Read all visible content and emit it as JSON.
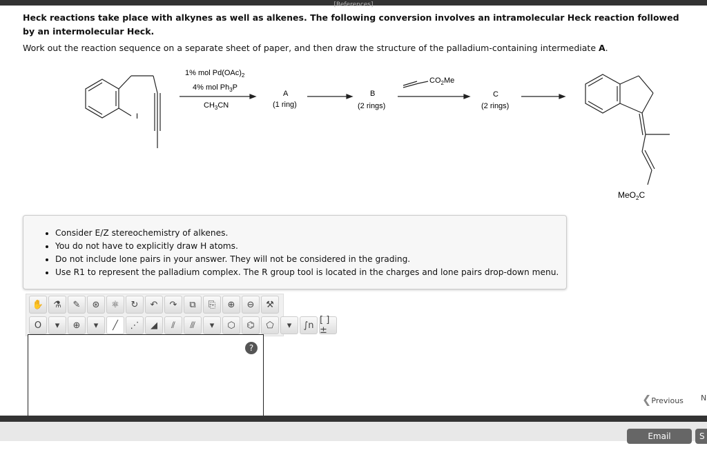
{
  "header": {
    "references": "[References]"
  },
  "question": {
    "title": "Heck reactions take place with alkynes as well as alkenes. The following conversion involves an intramolecular Heck reaction followed by an intermolecular Heck.",
    "instruction_prefix": "Work out the reaction sequence on a separate sheet of paper, and then draw the structure of the palladium-containing intermediate ",
    "instruction_bold": "A",
    "instruction_suffix": "."
  },
  "scheme": {
    "iodo": "I",
    "reagent1": "1% mol Pd(OAc)",
    "reagent1_sub": "2",
    "reagent2": "4% mol Ph",
    "reagent2_sub": "3",
    "reagent2_end": "P",
    "solvent": "CH",
    "solvent_sub": "3",
    "solvent_end": "CN",
    "A": "A",
    "A_note": "(1 ring)",
    "B": "B",
    "B_note": "(2 rings)",
    "alkene_reagent": "CO",
    "alkene_sub": "2",
    "alkene_end": "Me",
    "C": "C",
    "C_note": "(2 rings)",
    "product_ester": "MeO",
    "product_sub": "2",
    "product_end": "C"
  },
  "hints": [
    "Consider E/Z stereochemistry of alkenes.",
    "You do not have to explicitly draw H atoms.",
    "Do not include lone pairs in your answer. They will not be considered in the grading.",
    "Use R1 to represent the palladium complex. The R group tool is located in the charges and lone pairs drop-down menu."
  ],
  "toolbar": {
    "row1": [
      "✋",
      "⚗",
      "✎",
      "⊛",
      "⚛",
      "↻",
      "↶",
      "↷",
      "⧉",
      "⎘",
      "⊕",
      "⊖",
      "⚒"
    ],
    "row2": [
      "O",
      "▾",
      "⊕",
      "▾",
      "╱",
      "⋰",
      "◢",
      "⫽",
      "⫻",
      "▾",
      "⬡",
      "⌬",
      "⬠",
      "▾",
      "∫n",
      "[ ]±"
    ]
  },
  "canvas": {
    "help": "?"
  },
  "nav": {
    "previous": "Previous",
    "next": "N"
  },
  "footer": {
    "email": "Email Instructor",
    "save": "S"
  }
}
